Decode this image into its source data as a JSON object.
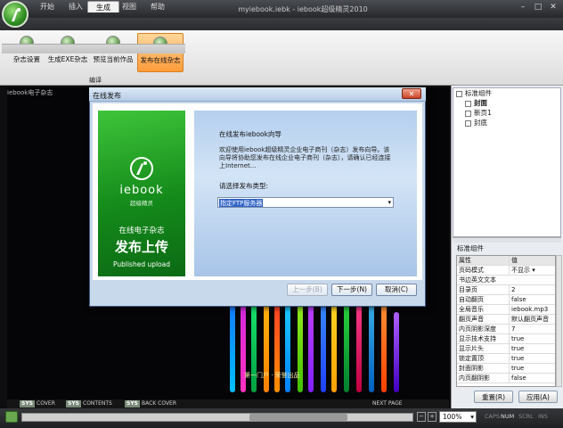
{
  "window": {
    "title": "myiebook.iebk - iebook超级精灵2010"
  },
  "tabs": [
    {
      "label": "开始"
    },
    {
      "label": "插入"
    },
    {
      "label": "生成",
      "active": true
    },
    {
      "label": "视图"
    },
    {
      "label": "帮助"
    }
  ],
  "ribbon": {
    "buttons": [
      {
        "label": "杂志设置",
        "icon": "settings-icon"
      },
      {
        "label": "生成EXE杂志",
        "icon": "exe-icon"
      },
      {
        "label": "预览当前作品",
        "icon": "preview-icon"
      },
      {
        "label": "发布在线杂志",
        "icon": "publish-icon",
        "active": true
      }
    ],
    "group_label": "编译"
  },
  "canvas": {
    "tab_label": "iebook电子杂志",
    "caption": "第一门户 · 荣誉出品",
    "nav": [
      {
        "key": "SYS",
        "label": "COVER"
      },
      {
        "key": "SYS",
        "label": "CONTENTS"
      },
      {
        "key": "SYS",
        "label": "BACK COVER"
      },
      {
        "key": "",
        "label": "NEXT PAGE"
      }
    ]
  },
  "tree": {
    "items": [
      {
        "label": "标准组件",
        "bold": false
      },
      {
        "label": "封面",
        "bold": true
      },
      {
        "label": "新页1",
        "bold": false
      },
      {
        "label": "封底",
        "bold": false
      }
    ]
  },
  "props": {
    "title": "标准组件",
    "header": {
      "key": "属性",
      "value": "值"
    },
    "rows": [
      {
        "key": "页码模式",
        "value": "不显示"
      },
      {
        "key": "书边英文文本",
        "value": ""
      },
      {
        "key": "目录页",
        "value": "2"
      },
      {
        "key": "自动翻页",
        "value": "false"
      },
      {
        "key": "全局音乐",
        "value": "iebook.mp3"
      },
      {
        "key": "翻页声音",
        "value": "默认翻页声音"
      },
      {
        "key": "内页阴影深度",
        "value": "7"
      },
      {
        "key": "显示技术支持",
        "value": "true"
      },
      {
        "key": "显示片头",
        "value": "true"
      },
      {
        "key": "锁定置顶",
        "value": "true"
      },
      {
        "key": "封面阴影",
        "value": "true"
      },
      {
        "key": "内页翻阴影",
        "value": "false"
      }
    ],
    "reset_label": "重置(R)",
    "apply_label": "应用(A)"
  },
  "statusbar": {
    "zoom": "100%",
    "indicators": [
      "CAPS",
      "NUM",
      "SCRL",
      "INS"
    ]
  },
  "dialog": {
    "title": "在线发布",
    "banner": {
      "brand": "iebook",
      "sub": "超级精灵",
      "line1": "在线电子杂志",
      "line2": "发布上传",
      "line3": "Published upload"
    },
    "heading": "在线发布iebook向导",
    "description": "欢迎使用iebook超级精灵企业电子商刊（杂志）发布向导。该向导将协助您发布在线企业电子商刊（杂志），请确认已经连接上Internet...",
    "select_label": "请选择发布类型:",
    "select_value": "指定FTP服务器",
    "back_label": "上一步(B)",
    "next_label": "下一步(N)",
    "cancel_label": "取消(C)"
  },
  "colors": {
    "accent_orange": "#ff9c3a",
    "brand_green": "#2a9a2a",
    "dialog_blue": "#b4cfee"
  }
}
